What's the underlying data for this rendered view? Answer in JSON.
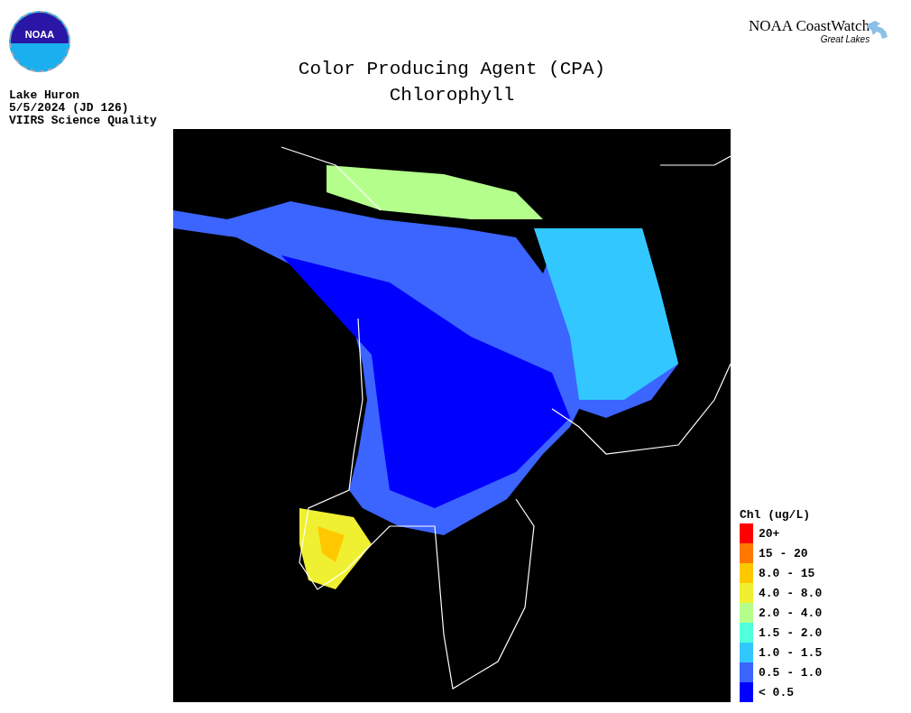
{
  "logo_left": {
    "text": "NOAA"
  },
  "logo_right": {
    "title": "NOAA CoastWatch",
    "subtitle": "Great Lakes"
  },
  "title": [
    "Color Producing Agent (CPA)",
    "Chlorophyll"
  ],
  "info": [
    "Lake Huron",
    "5/5/2024 (JD 126)",
    "VIIRS Science Quality"
  ],
  "legend": {
    "title": "Chl (ug/L)",
    "items": [
      {
        "label": "20+",
        "color": "#ff0000"
      },
      {
        "label": "15 - 20",
        "color": "#ff7800"
      },
      {
        "label": "8.0 - 15",
        "color": "#ffc800"
      },
      {
        "label": "4.0 - 8.0",
        "color": "#f0f032"
      },
      {
        "label": "2.0 - 4.0",
        "color": "#b4ff8c"
      },
      {
        "label": "1.5 - 2.0",
        "color": "#50ffdc"
      },
      {
        "label": "1.0 - 1.5",
        "color": "#32c8ff"
      },
      {
        "label": "0.5 - 1.0",
        "color": "#3c64ff"
      },
      {
        "label": "< 0.5",
        "color": "#0000ff"
      }
    ]
  }
}
